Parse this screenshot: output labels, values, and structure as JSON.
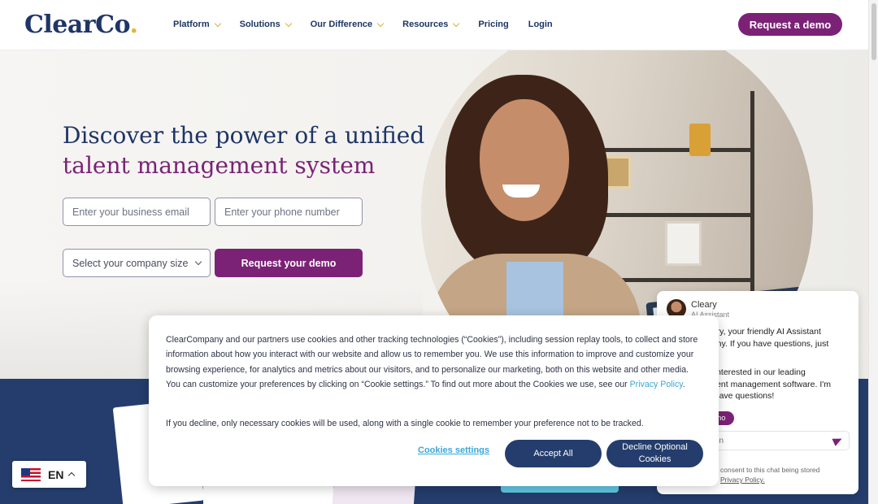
{
  "brand": {
    "logo_text": "ClearCo",
    "logo_main": "Clear",
    "logo_co": "Co",
    "logo_dot": ".",
    "primary_color": "#7b2276",
    "navy_color": "#1e3566",
    "accent_color": "#d8b23e",
    "link_color": "#3aa7d9"
  },
  "nav": {
    "items": [
      {
        "label": "Platform",
        "has_dropdown": true
      },
      {
        "label": "Solutions",
        "has_dropdown": true
      },
      {
        "label": "Our Difference",
        "has_dropdown": true
      },
      {
        "label": "Resources",
        "has_dropdown": true
      },
      {
        "label": "Pricing",
        "has_dropdown": false
      },
      {
        "label": "Login",
        "has_dropdown": false
      }
    ],
    "cta_label": "Request a demo"
  },
  "hero": {
    "title_line1": "Discover the power of a unified",
    "title_line2": "talent management system",
    "email_placeholder": "Enter your business email",
    "phone_placeholder": "Enter your phone number",
    "company_size_selected": "Select your company size",
    "submit_label": "Request your demo"
  },
  "chat": {
    "agent_name": "Cleary",
    "agent_role": "AI Assistant",
    "message1": "eary, your friendly AI Assistant\npany. If you have questions, just",
    "message2": "e interested in our leading\ntalent management software. I'm\nn have questions!",
    "chip_label": "no",
    "input_placeholder": "on",
    "consent_text": "consent to this chat being stored",
    "consent_link": "Privacy Policy."
  },
  "cookie_banner": {
    "text_before_link": "ClearCompany and our partners use cookies and other tracking technologies (“Cookies”), including session replay tools, to collect and store information about how you interact with our website and allow us to remember you. We use this information to improve and customize your browsing experience, for analytics and metrics about our visitors, and to personalize our marketing, both on this website and other media. You can customize your preferences by clicking on “Cookie settings.” To find out more about the Cookies we use, see our ",
    "privacy_link": "Privacy Policy",
    "text_after_link": ".",
    "decline_note": "If you decline, only necessary cookies will be used, along with a single cookie to remember your preference not to be tracked.",
    "settings_label": "Cookies settings",
    "accept_label": "Accept All",
    "decline_label": "Decline Optional Cookies"
  },
  "language": {
    "code": "EN",
    "flag_icon": "us-flag-icon"
  }
}
